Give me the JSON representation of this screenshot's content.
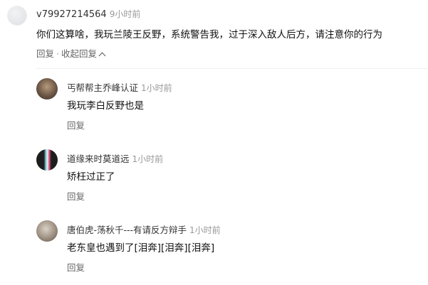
{
  "main_comment": {
    "username": "v79927214564",
    "time": "9小时前",
    "text": "你们这算啥，我玩兰陵王反野，系统警告我，过于深入敌人后方，请注意你的行为",
    "reply_label": "回复",
    "separator": "·",
    "collapse_label": "收起回复"
  },
  "replies": [
    {
      "username": "丐帮帮主乔峰认证",
      "time": "1小时前",
      "text": "我玩李白反野也是",
      "reply_label": "回复"
    },
    {
      "username": "道缘来时莫道远",
      "time": "1小时前",
      "text": "矫枉过正了",
      "reply_label": "回复"
    },
    {
      "username": "唐伯虎-荡秋千---有请反方辩手",
      "time": "1小时前",
      "text": "老东皇也遇到了[泪奔][泪奔][泪奔]",
      "reply_label": "回复"
    }
  ]
}
